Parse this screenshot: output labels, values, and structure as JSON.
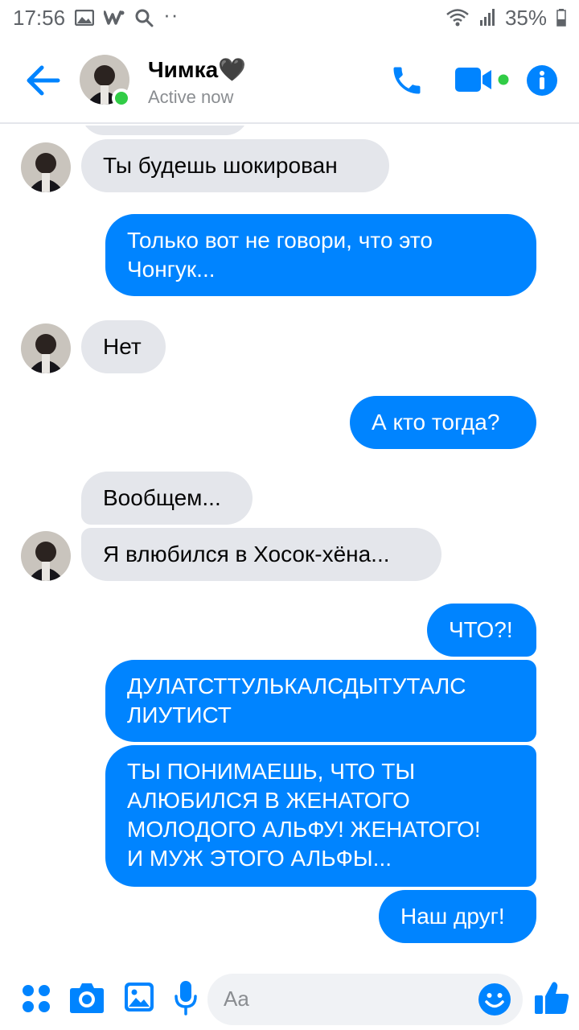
{
  "status_bar": {
    "time": "17:56",
    "left_icons": [
      "gallery-icon",
      "w-icon",
      "search-icon",
      "more-dots-icon"
    ],
    "more": "··",
    "battery": "35%",
    "right_icons": [
      "wifi-icon",
      "signal-icon",
      "battery-icon"
    ]
  },
  "header": {
    "contact_name": "Чимка🖤",
    "contact_status": "Active now",
    "colors": {
      "accent": "#0084ff",
      "online": "#31cc46"
    }
  },
  "messages": [
    {
      "sender": "contact",
      "text": ""
    },
    {
      "sender": "contact",
      "text": "Ты будешь шокирован"
    },
    {
      "sender": "me",
      "text": "Только вот не говори, что это\nЧонгук..."
    },
    {
      "sender": "contact",
      "text": "Нет"
    },
    {
      "sender": "me",
      "text": "А кто тогда?"
    },
    {
      "sender": "contact",
      "text": "Вообщем..."
    },
    {
      "sender": "contact",
      "text": "Я влюбился в Хосок-хёна..."
    },
    {
      "sender": "me",
      "text": "ЧТО?!"
    },
    {
      "sender": "me",
      "text": "ДУЛАТСТТУЛЬКАЛСДЫТУТАЛС\nЛИУТИСТ"
    },
    {
      "sender": "me",
      "text": "ТЫ ПОНИМАЕШЬ, ЧТО ТЫ\nАЛЮБИЛСЯ В ЖЕНАТОГО\nМОЛОДОГО АЛЬФУ! ЖЕНАТОГО!\nИ МУЖ ЭТОГО АЛЬФЫ..."
    },
    {
      "sender": "me",
      "text": "Наш друг!"
    }
  ],
  "composer": {
    "placeholder": "Aa",
    "icons": [
      "apps-icon",
      "camera-icon",
      "image-icon",
      "microphone-icon",
      "emoji-icon",
      "thumbs-up-icon"
    ]
  }
}
